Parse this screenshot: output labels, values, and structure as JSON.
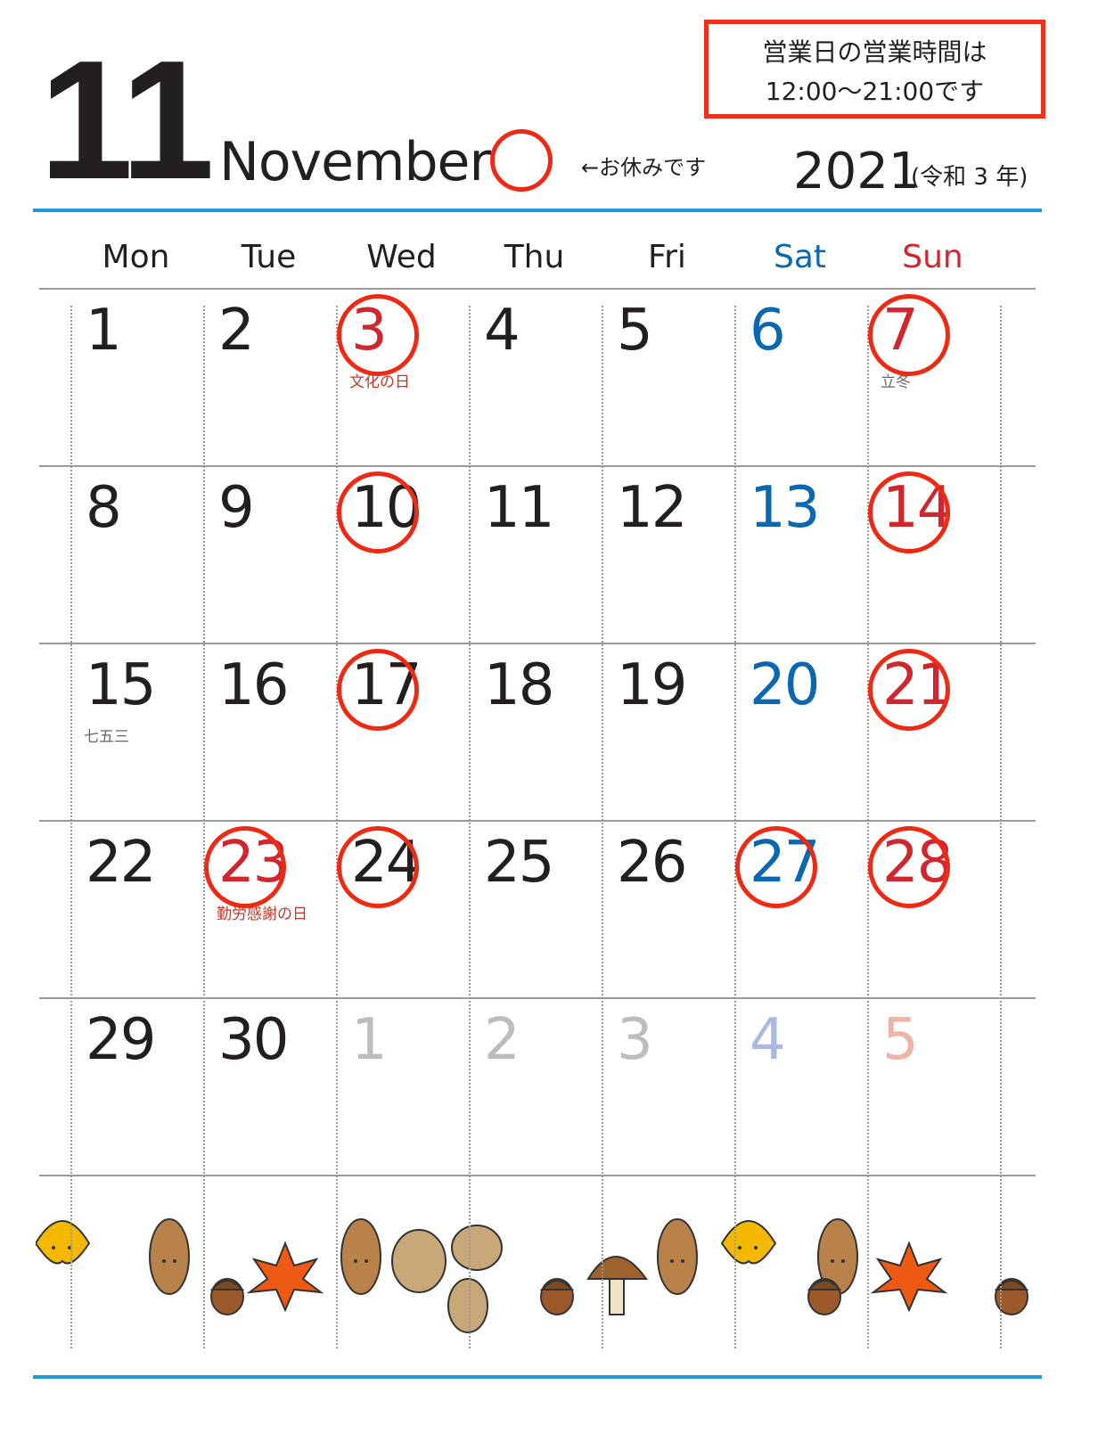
{
  "header": {
    "month_number": "11",
    "month_name": "November",
    "legend_text": "←お休みです",
    "hours_notice": [
      "営業日の営業時間は",
      "12:00〜21:00です"
    ],
    "year": "2021",
    "era": "(令和 3 年)"
  },
  "colors": {
    "rule": "#1e9ad6",
    "circle": "#ee2a14",
    "weekday": "#231f20",
    "saturday": "#0a67b0",
    "sunday": "#cf2630",
    "holiday_label": "#c0392b",
    "other_month_weekday": "#bdbdbd",
    "other_month_saturday": "#a9b9e0",
    "other_month_sunday": "#f0b3a6"
  },
  "weekdays": [
    {
      "label": "Mon",
      "type": "weekday"
    },
    {
      "label": "Tue",
      "type": "weekday"
    },
    {
      "label": "Wed",
      "type": "weekday"
    },
    {
      "label": "Thu",
      "type": "weekday"
    },
    {
      "label": "Fri",
      "type": "weekday"
    },
    {
      "label": "Sat",
      "type": "saturday"
    },
    {
      "label": "Sun",
      "type": "sunday"
    }
  ],
  "weeks": [
    [
      {
        "day": "1",
        "type": "weekday"
      },
      {
        "day": "2",
        "type": "weekday"
      },
      {
        "day": "3",
        "type": "sunday",
        "closed": true,
        "label": "文化の日"
      },
      {
        "day": "4",
        "type": "weekday"
      },
      {
        "day": "5",
        "type": "weekday"
      },
      {
        "day": "6",
        "type": "saturday"
      },
      {
        "day": "7",
        "type": "sunday",
        "closed": true,
        "label": "立冬",
        "label_type": "note"
      }
    ],
    [
      {
        "day": "8",
        "type": "weekday"
      },
      {
        "day": "9",
        "type": "weekday"
      },
      {
        "day": "10",
        "type": "weekday",
        "closed": true
      },
      {
        "day": "11",
        "type": "weekday"
      },
      {
        "day": "12",
        "type": "weekday"
      },
      {
        "day": "13",
        "type": "saturday"
      },
      {
        "day": "14",
        "type": "sunday",
        "closed": true
      }
    ],
    [
      {
        "day": "15",
        "type": "weekday",
        "label": "七五三",
        "label_type": "note"
      },
      {
        "day": "16",
        "type": "weekday"
      },
      {
        "day": "17",
        "type": "weekday",
        "closed": true
      },
      {
        "day": "18",
        "type": "weekday"
      },
      {
        "day": "19",
        "type": "weekday"
      },
      {
        "day": "20",
        "type": "saturday"
      },
      {
        "day": "21",
        "type": "sunday",
        "closed": true
      }
    ],
    [
      {
        "day": "22",
        "type": "weekday"
      },
      {
        "day": "23",
        "type": "sunday",
        "closed": true,
        "label": "勤労感謝の日"
      },
      {
        "day": "24",
        "type": "weekday",
        "closed": true
      },
      {
        "day": "25",
        "type": "weekday"
      },
      {
        "day": "26",
        "type": "weekday"
      },
      {
        "day": "27",
        "type": "saturday",
        "closed": true
      },
      {
        "day": "28",
        "type": "sunday",
        "closed": true
      }
    ],
    [
      {
        "day": "29",
        "type": "weekday"
      },
      {
        "day": "30",
        "type": "weekday"
      },
      {
        "day": "1",
        "type": "other_month_weekday"
      },
      {
        "day": "2",
        "type": "other_month_weekday"
      },
      {
        "day": "3",
        "type": "other_month_weekday"
      },
      {
        "day": "4",
        "type": "other_month_saturday"
      },
      {
        "day": "5",
        "type": "other_month_sunday"
      }
    ]
  ],
  "decoration": {
    "icons": [
      "ginkgo-leaf-icon",
      "brown-leaf-icon",
      "acorn-icon",
      "maple-leaf-icon",
      "brown-leaf-icon",
      "squirrel-icon",
      "acorn-icon",
      "mushroom-icon",
      "brown-leaf-icon",
      "ginkgo-leaf-icon",
      "brown-leaf-icon",
      "acorn-icon",
      "maple-leaf-icon",
      "acorn-icon"
    ]
  }
}
